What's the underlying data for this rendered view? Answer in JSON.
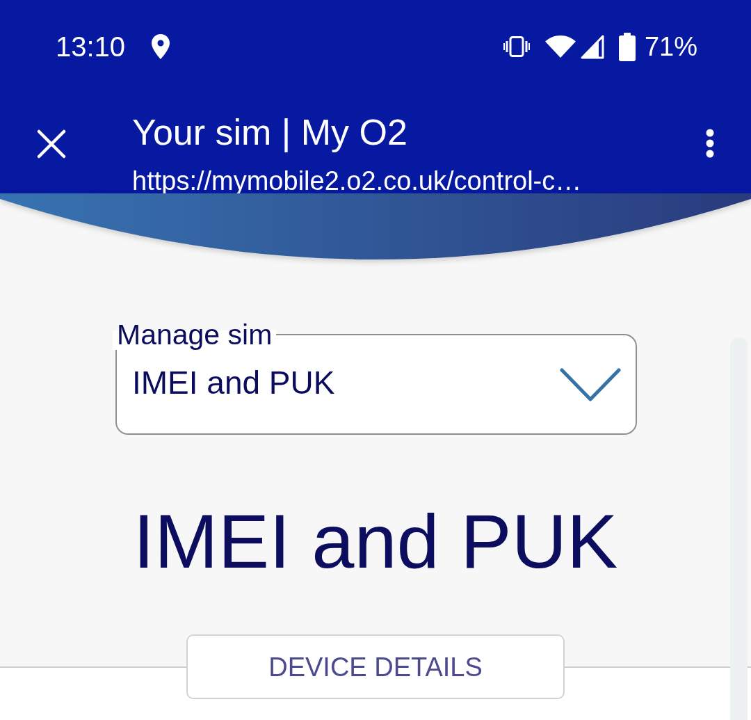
{
  "status_bar": {
    "time": "13:10",
    "battery": "71%"
  },
  "toolbar": {
    "title": "Your sim | My O2",
    "url": "https://mymobile2.o2.co.uk/control-c…"
  },
  "select": {
    "label": "Manage sim",
    "value": "IMEI and PUK"
  },
  "heading": "IMEI and PUK",
  "button": {
    "label": "DEVICE DETAILS"
  }
}
